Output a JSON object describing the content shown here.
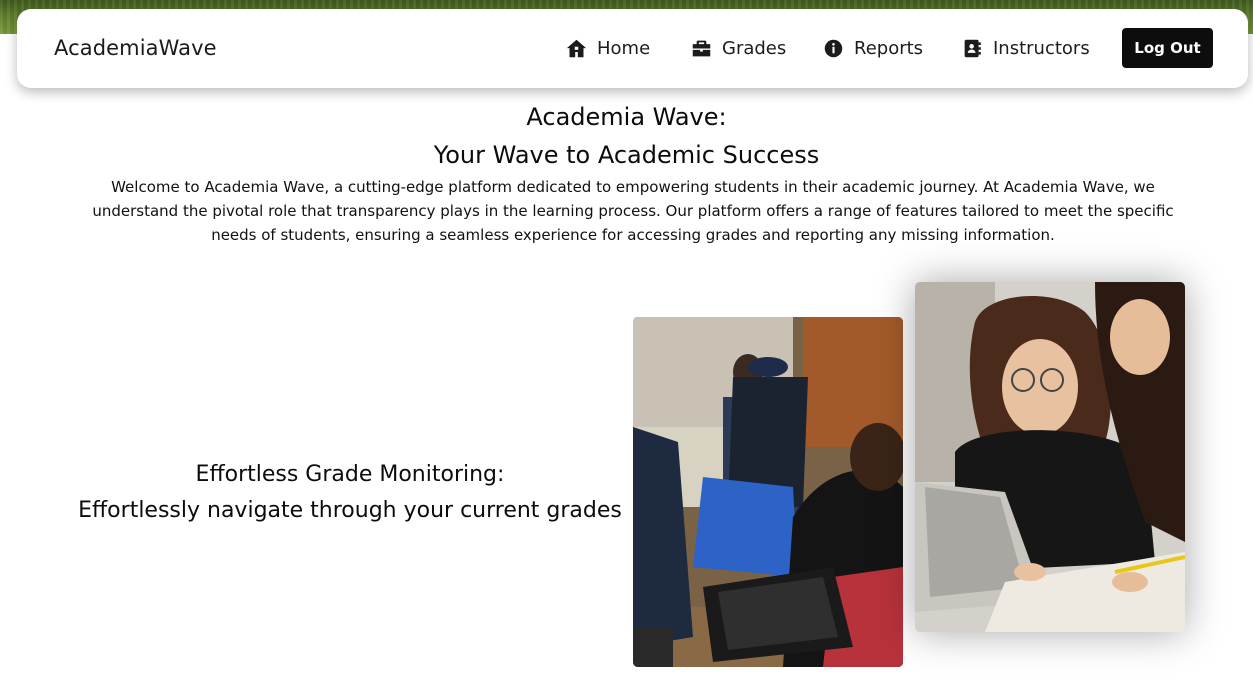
{
  "brand": "AcademiaWave",
  "nav": {
    "home": "Home",
    "grades": "Grades",
    "reports": "Reports",
    "instructors": "Instructors",
    "logout": "Log Out"
  },
  "hero": {
    "title_line1": "Academia Wave:",
    "title_line2": "Your Wave to Academic Success",
    "intro": "Welcome to Academia Wave, a cutting-edge platform dedicated to empowering students in their academic journey. At Academia Wave, we understand the pivotal role that transparency plays in the learning process. Our platform offers a range of features tailored to meet the specific needs of students, ensuring a seamless experience for accessing grades and reporting any missing information."
  },
  "feature": {
    "title": "Effortless Grade Monitoring:",
    "subtitle": "Effortlessly navigate through your current grades"
  },
  "icons": {
    "home": "home-icon",
    "grades": "briefcase-icon",
    "reports": "info-circle-icon",
    "instructors": "address-book-icon"
  },
  "colors": {
    "logout_bg": "#0d0d0d",
    "nav_text": "#1c1c1c",
    "banner": "#5d7d2a"
  }
}
